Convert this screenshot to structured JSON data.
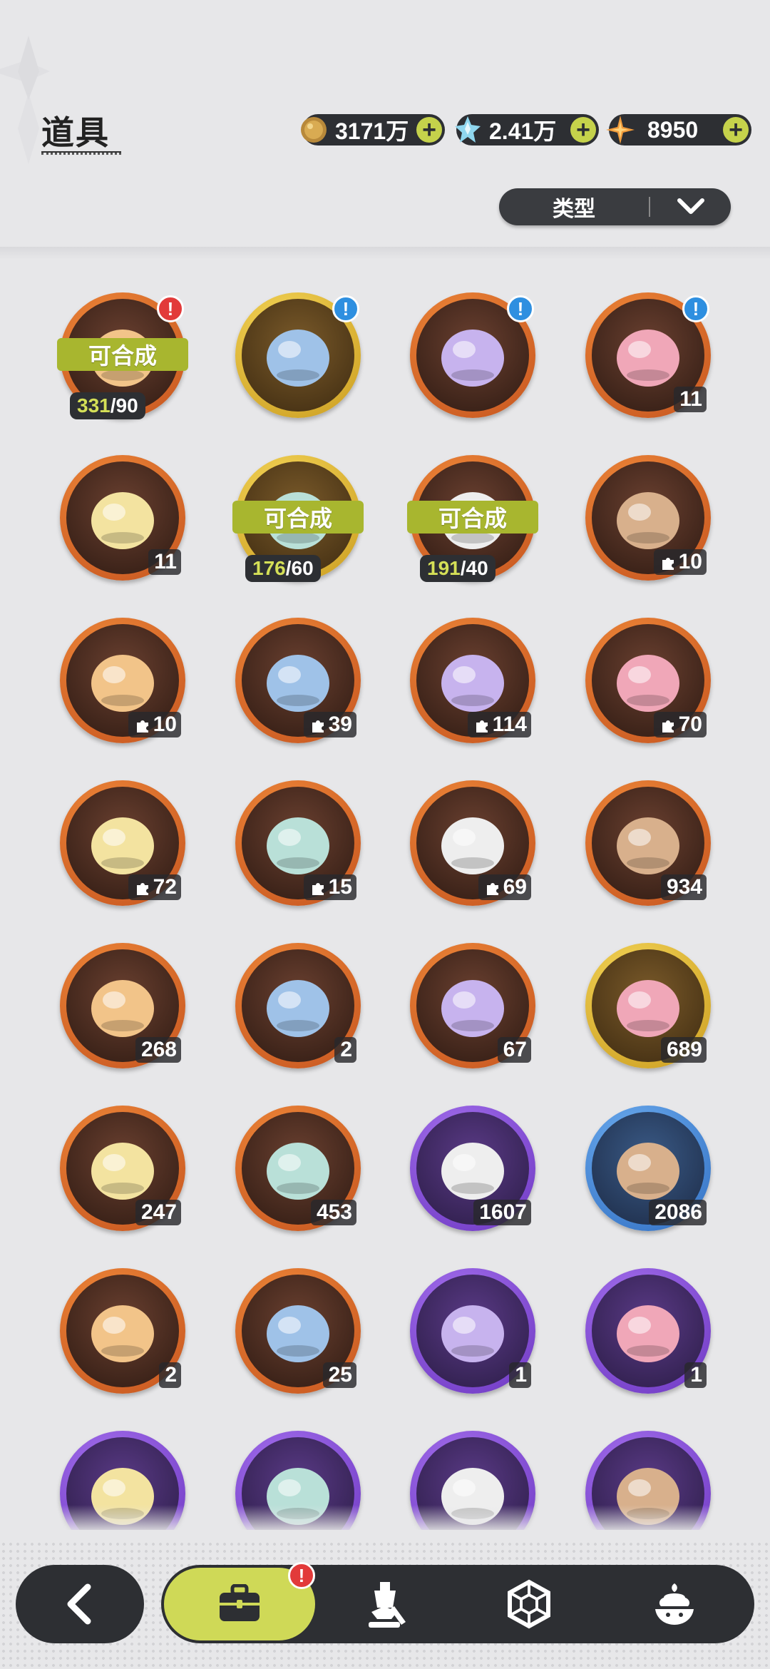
{
  "header": {
    "title": "道具",
    "currencies": [
      {
        "name": "gold",
        "value": "3171万",
        "icon": "gold-coin-icon"
      },
      {
        "name": "crystal",
        "value": "2.41万",
        "icon": "blue-crystal-icon"
      },
      {
        "name": "star-shard",
        "value": "8950",
        "icon": "orange-star-icon"
      }
    ],
    "plus_label": "+",
    "filter_label": "类型"
  },
  "colors": {
    "orange_ring": "#e1702f",
    "gold_ring": "#e8c13a",
    "purple_ring": "#8a4fd8",
    "blue_ring": "#3e86d8",
    "accent_green": "#cfd957"
  },
  "items": [
    {
      "name": "hamster-fragment",
      "ring": "orange",
      "craft": "可合成",
      "have": "331",
      "need": "/90",
      "badge": "!",
      "badge_type": "alert",
      "icon": "hamster-icon"
    },
    {
      "name": "chest-blue-gold",
      "ring": "gold",
      "badge": "!",
      "badge_type": "info",
      "icon": "treasure-chest-icon"
    },
    {
      "name": "chest-blue",
      "ring": "orange",
      "badge": "!",
      "badge_type": "info",
      "icon": "treasure-chest-icon"
    },
    {
      "name": "chest-purple",
      "ring": "orange",
      "badge": "!",
      "badge_type": "info",
      "count": "11",
      "icon": "purple-chest-icon"
    },
    {
      "name": "purple-crystal-emblem",
      "ring": "orange",
      "count": "11",
      "icon": "purple-crystal-icon"
    },
    {
      "name": "golden-hamster-fragment",
      "ring": "gold",
      "craft": "可合成",
      "have": "176",
      "need": "/60",
      "icon": "hamster-icon"
    },
    {
      "name": "hamster-fragment-2",
      "ring": "orange",
      "craft": "可合成",
      "have": "191",
      "need": "/40",
      "icon": "hamster-icon"
    },
    {
      "name": "white-cat-fragment",
      "ring": "orange",
      "count": "10",
      "fragment": true,
      "icon": "white-cat-icon"
    },
    {
      "name": "fox-mask-fragment",
      "ring": "orange",
      "count": "10",
      "fragment": true,
      "icon": "fox-icon"
    },
    {
      "name": "bear-fragment",
      "ring": "orange",
      "count": "39",
      "fragment": true,
      "icon": "bear-icon"
    },
    {
      "name": "knight-fragment",
      "ring": "orange",
      "count": "114",
      "fragment": true,
      "icon": "knight-icon"
    },
    {
      "name": "white-creature-fragment",
      "ring": "orange",
      "count": "70",
      "fragment": true,
      "icon": "creature-icon"
    },
    {
      "name": "cat-fragment",
      "ring": "orange",
      "count": "72",
      "fragment": true,
      "icon": "cat-icon"
    },
    {
      "name": "dark-bear-fragment",
      "ring": "orange",
      "count": "15",
      "fragment": true,
      "icon": "bear-icon"
    },
    {
      "name": "lilac-creature-fragment",
      "ring": "orange",
      "count": "69",
      "fragment": true,
      "icon": "creature-icon"
    },
    {
      "name": "pink-crystal",
      "ring": "orange",
      "count": "934",
      "icon": "pink-crystal-icon"
    },
    {
      "name": "blue-crystal",
      "ring": "orange",
      "count": "268",
      "icon": "blue-crystal-icon"
    },
    {
      "name": "red-paw-charm",
      "ring": "orange",
      "count": "2",
      "icon": "paw-charm-icon"
    },
    {
      "name": "gold-paw-charm",
      "ring": "orange",
      "count": "67",
      "icon": "paw-charm-icon"
    },
    {
      "name": "gold-card",
      "ring": "gold",
      "count": "689",
      "icon": "card-icon"
    },
    {
      "name": "rainbow-card",
      "ring": "orange",
      "count": "247",
      "icon": "card-icon"
    },
    {
      "name": "amber-card",
      "ring": "orange",
      "count": "453",
      "icon": "card-icon"
    },
    {
      "name": "purple-card",
      "ring": "purple",
      "count": "1607",
      "icon": "card-icon"
    },
    {
      "name": "blue-card",
      "ring": "blue",
      "count": "2086",
      "icon": "card-icon"
    },
    {
      "name": "refresh-card",
      "ring": "orange",
      "count": "2",
      "icon": "refresh-card-icon"
    },
    {
      "name": "clover-card",
      "ring": "orange",
      "count": "25",
      "icon": "clover-card-icon"
    },
    {
      "name": "horn-ornament",
      "ring": "purple",
      "count": "1",
      "icon": "horn-icon"
    },
    {
      "name": "gift-box",
      "ring": "purple",
      "count": "1",
      "icon": "gift-box-icon"
    },
    {
      "name": "golden-bell",
      "ring": "purple",
      "icon": "bell-icon"
    },
    {
      "name": "mirror",
      "ring": "purple",
      "icon": "mirror-icon"
    },
    {
      "name": "scroll",
      "ring": "purple",
      "icon": "scroll-icon"
    },
    {
      "name": "pink-apple",
      "ring": "purple",
      "icon": "apple-icon"
    }
  ],
  "nav": {
    "back_icon": "chevron-left-icon",
    "tabs": [
      {
        "name": "bag",
        "icon": "briefcase-icon",
        "active": true,
        "badge": "!"
      },
      {
        "name": "characters",
        "icon": "knight-chess-icon"
      },
      {
        "name": "gems",
        "icon": "hexagon-icon"
      },
      {
        "name": "cuisine",
        "icon": "dessert-icon"
      }
    ]
  }
}
